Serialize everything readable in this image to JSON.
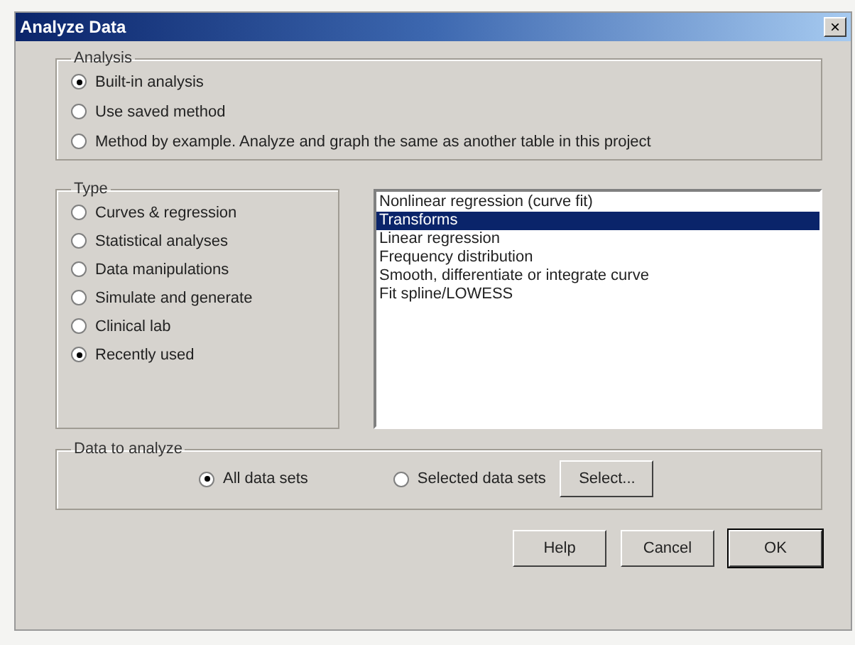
{
  "window": {
    "title": "Analyze Data",
    "close": "×"
  },
  "analysis": {
    "legend": "Analysis",
    "options": [
      {
        "label": "Built-in analysis",
        "selected": true
      },
      {
        "label": "Use saved method",
        "selected": false
      },
      {
        "label": "Method by example. Analyze and graph the same as another table in this project",
        "selected": false
      }
    ]
  },
  "type": {
    "legend": "Type",
    "options": [
      {
        "label": "Curves & regression",
        "selected": false
      },
      {
        "label": "Statistical analyses",
        "selected": false
      },
      {
        "label": "Data manipulations",
        "selected": false
      },
      {
        "label": "Simulate and generate",
        "selected": false
      },
      {
        "label": "Clinical lab",
        "selected": false
      },
      {
        "label": "Recently used",
        "selected": true
      }
    ]
  },
  "list": {
    "items": [
      {
        "label": "Nonlinear regression (curve fit)",
        "selected": false
      },
      {
        "label": "Transforms",
        "selected": true
      },
      {
        "label": "Linear regression",
        "selected": false
      },
      {
        "label": "Frequency distribution",
        "selected": false
      },
      {
        "label": "Smooth, differentiate or integrate curve",
        "selected": false
      },
      {
        "label": "Fit spline/LOWESS",
        "selected": false
      }
    ]
  },
  "data_to_analyze": {
    "legend": "Data to analyze",
    "options": [
      {
        "label": "All data sets",
        "selected": true
      },
      {
        "label": "Selected data sets",
        "selected": false
      }
    ],
    "select_button": "Select..."
  },
  "buttons": [
    "Help",
    "Cancel",
    "OK"
  ]
}
